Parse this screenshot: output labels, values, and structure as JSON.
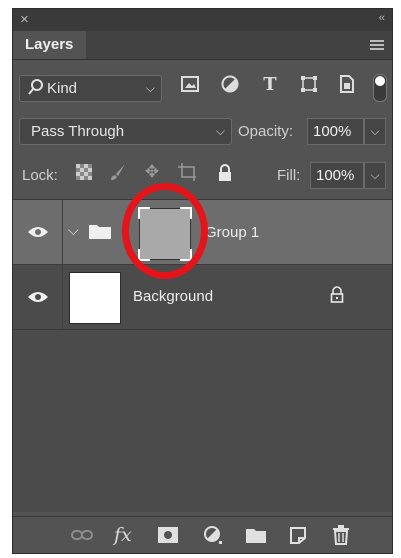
{
  "panel": {
    "tab_title": "Layers",
    "close_glyph": "×",
    "collapse_glyph": "‹‹"
  },
  "filter": {
    "kind_label": "Kind",
    "icons": [
      "pixel-filter-icon",
      "adjustment-filter-icon",
      "type-filter-icon",
      "shape-filter-icon",
      "smart-object-filter-icon"
    ],
    "filter_toggle": "on"
  },
  "blend": {
    "mode": "Pass Through",
    "opacity_label": "Opacity:",
    "opacity_value": "100%"
  },
  "lock": {
    "label": "Lock:",
    "fill_label": "Fill:",
    "fill_value": "100%"
  },
  "layers": [
    {
      "name": "Group 1",
      "type": "group",
      "visible": true,
      "selected": true,
      "expanded": false
    },
    {
      "name": "Background",
      "type": "pixel",
      "visible": true,
      "selected": false,
      "locked": true
    }
  ],
  "annotation": {
    "color": "#e4141b",
    "shape": "ellipse",
    "target": "Group 1 thumbnail"
  },
  "bottom_bar": {
    "fx_label": "fx",
    "icons": [
      "link-layers-icon",
      "fx-icon",
      "layer-mask-icon",
      "adjustment-layer-icon",
      "new-group-icon",
      "new-layer-icon",
      "delete-layer-icon"
    ]
  }
}
